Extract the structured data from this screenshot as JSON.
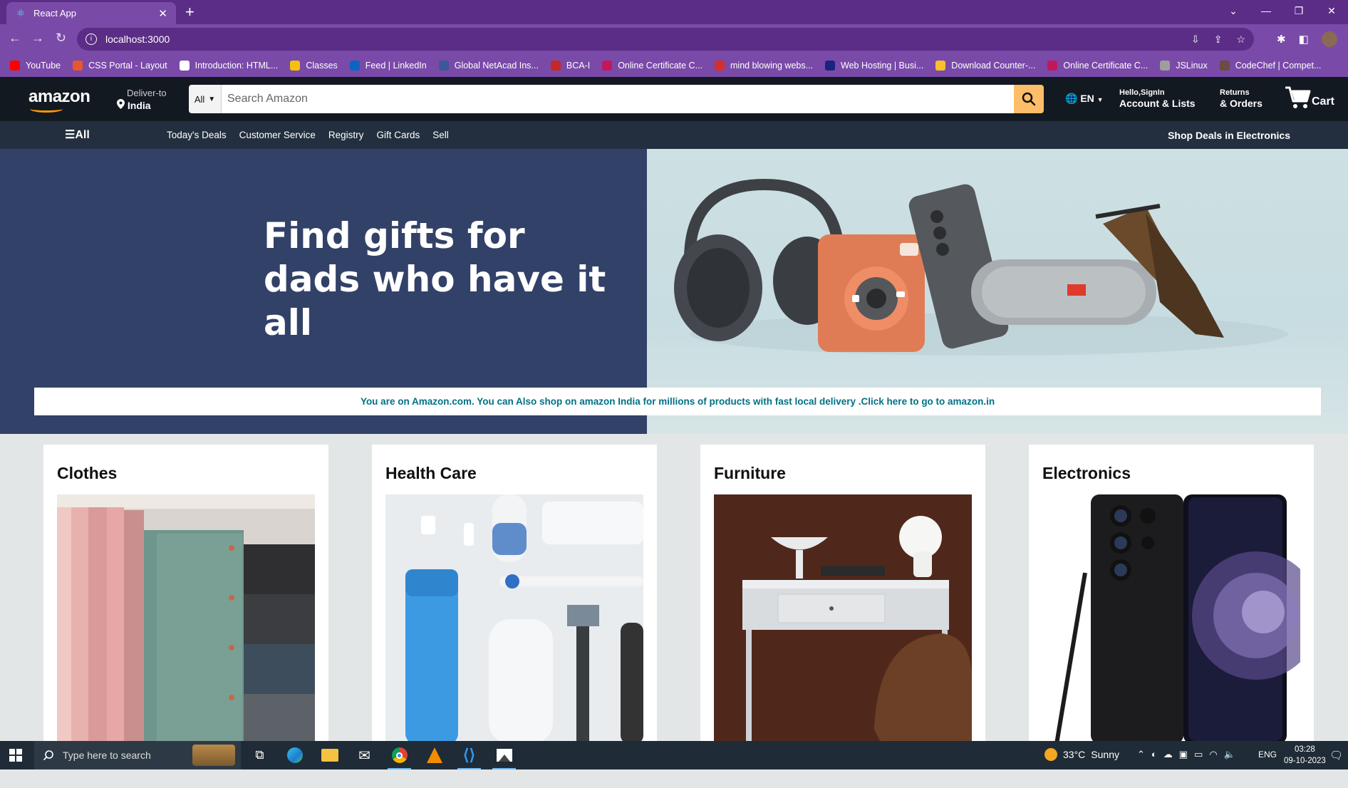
{
  "browser": {
    "tab_title": "React App",
    "new_tab_symbol": "+",
    "url": "localhost:3000",
    "bookmarks": [
      {
        "label": "YouTube",
        "color": "#ff0000"
      },
      {
        "label": "CSS Portal - Layout",
        "color": "#e8552f"
      },
      {
        "label": "Introduction: HTML...",
        "color": "#ffffff"
      },
      {
        "label": "Classes",
        "color": "#f4c20d"
      },
      {
        "label": "Feed | LinkedIn",
        "color": "#0a66c2"
      },
      {
        "label": "Global NetAcad Ins...",
        "color": "#3b5998"
      },
      {
        "label": "BCA-I",
        "color": "#c62828"
      },
      {
        "label": "Online Certificate C...",
        "color": "#c2185b"
      },
      {
        "label": "mind blowing webs...",
        "color": "#d32f2f"
      },
      {
        "label": "Web Hosting | Busi...",
        "color": "#1a237e"
      },
      {
        "label": "Download Counter-...",
        "color": "#fbc02d"
      },
      {
        "label": "Online Certificate C...",
        "color": "#c2185b"
      },
      {
        "label": "JSLinux",
        "color": "#9e9e9e"
      },
      {
        "label": "CodeChef | Compet...",
        "color": "#6d4c41"
      }
    ]
  },
  "header": {
    "logo_text": "amazon",
    "deliver_line1": "Deliver-to",
    "deliver_line2": "India",
    "search_category": "All",
    "search_placeholder": "Search Amazon",
    "language": "EN",
    "account_line1": "Hello,SignIn",
    "account_line2": "Account & Lists",
    "returns_line1": "Returns",
    "returns_line2": "& Orders",
    "cart_label": "Cart"
  },
  "subnav": {
    "all_label": "All",
    "links": [
      "Today's Deals",
      "Customer Service",
      "Registry",
      "Gift Cards",
      "Sell"
    ],
    "promo": "Shop Deals in Electronics"
  },
  "hero": {
    "title_line1": "Find gifts for",
    "title_line2": "dads who have it all",
    "notice": "You are on Amazon.com. You can Also shop on amazon India for millions of products with fast local delivery .Click here to go to amazon.in"
  },
  "cards": [
    {
      "title": "Clothes"
    },
    {
      "title": "Health Care"
    },
    {
      "title": "Furniture"
    },
    {
      "title": "Electronics"
    }
  ],
  "taskbar": {
    "search_placeholder": "Type here to search",
    "weather_temp": "33°C",
    "weather_text": "Sunny",
    "language": "ENG",
    "time": "03:28",
    "date": "09-10-2023"
  },
  "colors": {
    "browser_frame": "#7a4aa8",
    "amazon_header": "#131921",
    "amazon_subnav": "#232f3e",
    "search_button": "#febd69",
    "hero_left": "#324168",
    "notice_text": "#007185"
  }
}
